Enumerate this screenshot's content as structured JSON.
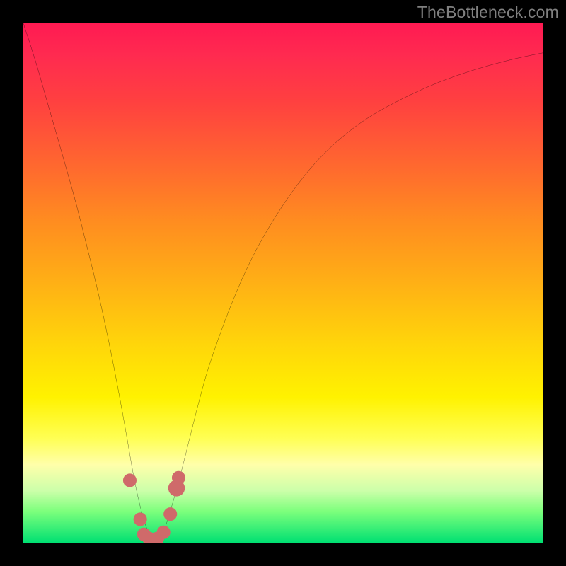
{
  "watermark": "TheBottleneck.com",
  "chart_data": {
    "type": "line",
    "title": "",
    "xlabel": "",
    "ylabel": "",
    "xlim": [
      0,
      100
    ],
    "ylim": [
      0,
      100
    ],
    "background_gradient": {
      "stops": [
        {
          "pos": 0,
          "color": "#ff1a52"
        },
        {
          "pos": 15,
          "color": "#ff4040"
        },
        {
          "pos": 38,
          "color": "#ff8c20"
        },
        {
          "pos": 62,
          "color": "#ffd60a"
        },
        {
          "pos": 80,
          "color": "#ffff55"
        },
        {
          "pos": 90,
          "color": "#ccffaa"
        },
        {
          "pos": 100,
          "color": "#00e072"
        }
      ]
    },
    "series": [
      {
        "name": "bottleneck-curve",
        "color": "#000000",
        "x": [
          0,
          2,
          4,
          6,
          8,
          10,
          12,
          14,
          16,
          18,
          20,
          21,
          22,
          23,
          24,
          25,
          26,
          27,
          28,
          30,
          32,
          34,
          36,
          40,
          44,
          48,
          52,
          56,
          60,
          65,
          70,
          75,
          80,
          85,
          90,
          95,
          100
        ],
        "y": [
          100,
          94,
          87,
          80,
          73,
          66,
          58,
          50,
          41,
          31,
          20,
          14,
          9,
          5,
          2,
          0.5,
          0.5,
          2,
          5,
          12,
          20,
          28,
          35,
          46,
          55,
          62,
          68,
          73,
          77,
          81,
          84,
          86.5,
          88.7,
          90.5,
          92,
          93.3,
          94.3
        ]
      }
    ],
    "markers": [
      {
        "x": 20.5,
        "y": 12,
        "r": 1.3
      },
      {
        "x": 22.5,
        "y": 4.5,
        "r": 1.3
      },
      {
        "x": 23.2,
        "y": 1.6,
        "r": 1.3
      },
      {
        "x": 24.2,
        "y": 0.8,
        "r": 1.3
      },
      {
        "x": 25.8,
        "y": 0.8,
        "r": 1.3
      },
      {
        "x": 27.0,
        "y": 2.0,
        "r": 1.3
      },
      {
        "x": 28.3,
        "y": 5.5,
        "r": 1.3
      },
      {
        "x": 29.5,
        "y": 10.5,
        "r": 1.6
      },
      {
        "x": 29.9,
        "y": 12.5,
        "r": 1.3
      }
    ]
  }
}
